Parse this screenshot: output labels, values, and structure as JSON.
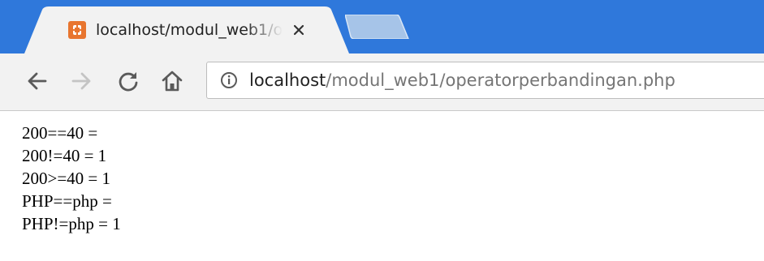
{
  "browser": {
    "tab": {
      "title": "localhost/modul_web1/o",
      "favicon": "xampp-icon",
      "close_glyph": "✕"
    },
    "address_bar": {
      "host": "localhost",
      "path": "/modul_web1/operatorperbandingan.php"
    },
    "icons": {
      "back": "back-arrow-icon",
      "forward": "forward-arrow-icon",
      "reload": "reload-icon",
      "home": "home-icon",
      "site_info": "info-icon"
    },
    "colors": {
      "tabstrip": "#2f78db",
      "favicon": "#e8752f",
      "toolbar": "#f2f2f2",
      "new_tab": "#a6c4e8"
    }
  },
  "page": {
    "lines": [
      "200==40 =",
      "200!=40 = 1",
      "200>=40 = 1",
      "PHP==php =",
      "PHP!=php = 1"
    ]
  }
}
